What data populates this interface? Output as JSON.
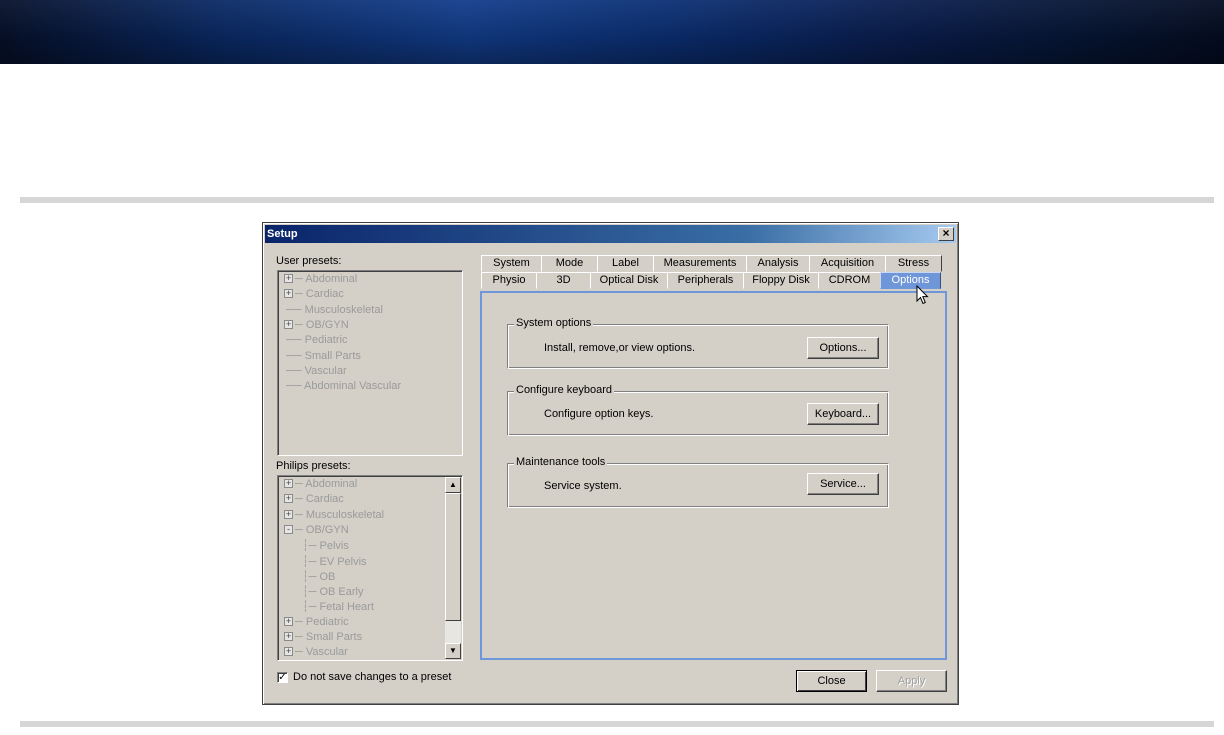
{
  "dialog": {
    "title": "Setup",
    "close_glyph": "×"
  },
  "user_presets": {
    "label": "User presets:",
    "items": [
      {
        "label": "Abdominal",
        "expandable": true
      },
      {
        "label": "Cardiac",
        "expandable": true
      },
      {
        "label": "Musculoskeletal",
        "expandable": false
      },
      {
        "label": "OB/GYN",
        "expandable": true
      },
      {
        "label": "Pediatric",
        "expandable": false
      },
      {
        "label": "Small Parts",
        "expandable": false
      },
      {
        "label": "Vascular",
        "expandable": false
      },
      {
        "label": "Abdominal Vascular",
        "expandable": false
      }
    ]
  },
  "philips_presets": {
    "label": "Philips presets:",
    "items": [
      {
        "label": "Abdominal",
        "expandable": true
      },
      {
        "label": "Cardiac",
        "expandable": true
      },
      {
        "label": "Musculoskeletal",
        "expandable": true
      },
      {
        "label": "OB/GYN",
        "expandable": true,
        "expanded": true
      },
      {
        "label": "Pelvis",
        "child": true
      },
      {
        "label": "EV Pelvis",
        "child": true
      },
      {
        "label": "OB",
        "child": true
      },
      {
        "label": "OB Early",
        "child": true
      },
      {
        "label": "Fetal Heart",
        "child": true
      },
      {
        "label": "Pediatric",
        "expandable": true
      },
      {
        "label": "Small Parts",
        "expandable": true
      },
      {
        "label": "Vascular",
        "expandable": true
      }
    ]
  },
  "tabs": {
    "row1": [
      "System",
      "Mode",
      "Label",
      "Measurements",
      "Analysis",
      "Acquisition",
      "Stress"
    ],
    "row2": [
      "Physio",
      "3D",
      "Optical Disk",
      "Peripherals",
      "Floppy Disk",
      "CDROM",
      "Options"
    ],
    "active": "Options"
  },
  "groups": {
    "system_options": {
      "title": "System options",
      "desc": "Install, remove,or view options.",
      "button": "Options..."
    },
    "configure_keyboard": {
      "title": "Configure keyboard",
      "desc": "Configure option keys.",
      "button": "Keyboard..."
    },
    "maintenance_tools": {
      "title": "Maintenance tools",
      "desc": "Service system.",
      "button": "Service..."
    }
  },
  "footer": {
    "checkbox_label": "Do not save changes to a preset",
    "checkbox_checked": true,
    "check_glyph": "✓",
    "close_button": "Close",
    "apply_button": "Apply"
  },
  "icons": {
    "expand": "+",
    "collapse": "-",
    "scroll_up": "▲",
    "scroll_down": "▼"
  },
  "colors": {
    "dialog_face": "#d4d0c8",
    "active_tab": "#6f96d8",
    "title_bar_start": "#0a246a"
  }
}
